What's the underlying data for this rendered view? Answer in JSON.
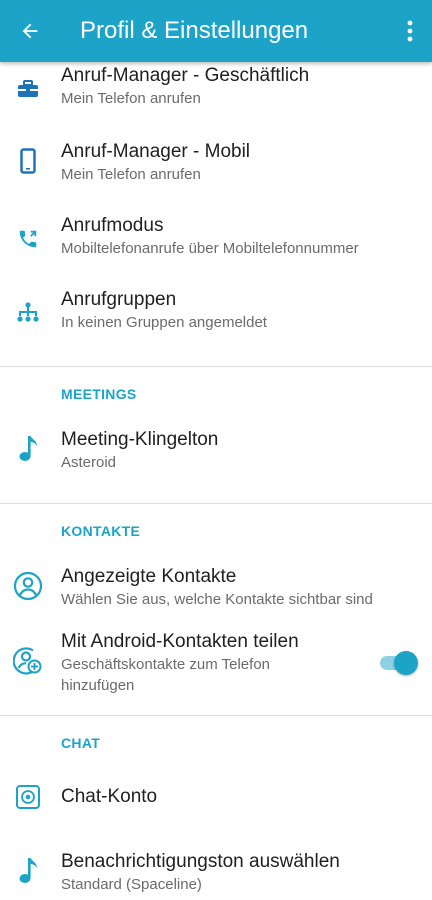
{
  "appbar": {
    "title": "Profil & Einstellungen",
    "back_icon": "arrow-back-icon",
    "menu_icon": "more-vert-icon",
    "color": "#1ea3c8"
  },
  "accent_color": "#1ea3c8",
  "items": {
    "business": {
      "title": "Anruf-Manager - Geschäftlich",
      "subtitle": "Mein Telefon anrufen",
      "icon": "briefcase-icon"
    },
    "mobile": {
      "title": "Anruf-Manager - Mobil",
      "subtitle": "Mein Telefon anrufen",
      "icon": "smartphone-icon"
    },
    "callmode": {
      "title": "Anrufmodus",
      "subtitle": "Mobiltelefonanrufe über Mobiltelefonnummer",
      "icon": "phone-callback-icon"
    },
    "groups": {
      "title": "Anrufgruppen",
      "subtitle": "In keinen Gruppen angemeldet",
      "icon": "hierarchy-icon"
    }
  },
  "meetings": {
    "header": "MEETINGS",
    "ringtone": {
      "title": "Meeting-Klingelton",
      "subtitle": "Asteroid",
      "icon": "music-note-icon"
    }
  },
  "contacts": {
    "header": "KONTAKTE",
    "shown": {
      "title": "Angezeigte Kontakte",
      "subtitle": "Wählen Sie aus, welche Kontakte sichtbar sind",
      "icon": "account-circle-icon"
    },
    "share": {
      "title": "Mit Android-Kontakten teilen",
      "subtitle": "Geschäftskontakte zum Telefon hinzufügen",
      "icon": "contact-add-icon",
      "toggle_on": true
    }
  },
  "chat": {
    "header": "CHAT",
    "account": {
      "title": "Chat-Konto",
      "icon": "chat-account-icon"
    },
    "notification": {
      "title": "Benachrichtigungston auswählen",
      "subtitle": "Standard (Spaceline)",
      "icon": "music-note-icon"
    }
  }
}
